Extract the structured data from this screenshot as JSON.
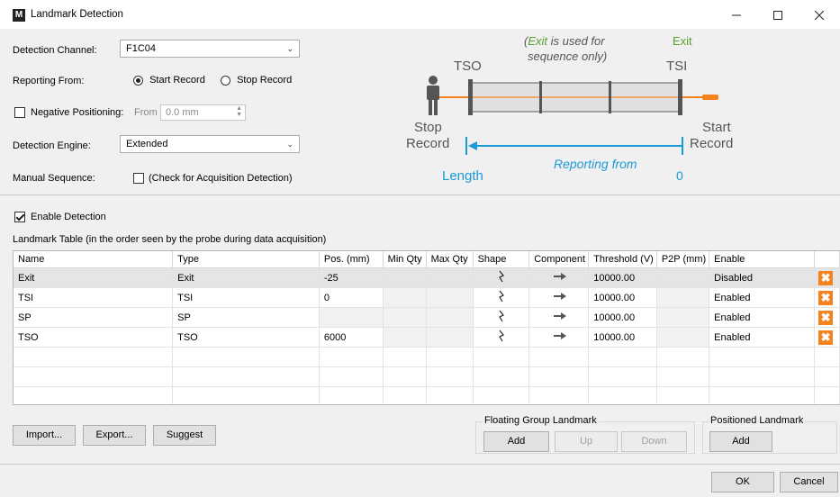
{
  "window": {
    "app_icon": "M",
    "title": "Landmark Detection",
    "minimize_icon": "minimize-icon",
    "maximize_icon": "maximize-icon",
    "close_icon": "close-icon"
  },
  "settings": {
    "detection_channel_label": "Detection Channel:",
    "detection_channel_value": "F1C04",
    "reporting_from_label": "Reporting From:",
    "reporting_options": [
      "Start Record",
      "Stop Record"
    ],
    "reporting_selected": "Start Record",
    "negative_positioning_label": "Negative Positioning:",
    "negative_positioning_checked": false,
    "from_label": "From",
    "from_value": "0.0 mm",
    "detection_engine_label": "Detection Engine:",
    "detection_engine_value": "Extended",
    "manual_sequence_label": "Manual Sequence:",
    "manual_sequence_checkbox_label": "(Check for Acquisition Detection)",
    "manual_sequence_checked": false
  },
  "diagram": {
    "note_exit": "Exit",
    "note_rest": " is used for",
    "note_line2": "sequence only)",
    "note_open_paren": "(",
    "exit_label": "Exit",
    "tso_label": "TSO",
    "tsi_label": "TSI",
    "stop_label_1": "Stop",
    "stop_label_2": "Record",
    "start_label_1": "Start",
    "start_label_2": "Record",
    "length_label": "Length",
    "reporting_from_label": "Reporting from",
    "zero_label": "0",
    "colors": {
      "orange": "#f5821f",
      "blue": "#1a9ad6",
      "green": "#5aa02c",
      "grey_text": "#555555"
    }
  },
  "enable_detection": {
    "label": "Enable Detection",
    "checked": true
  },
  "table": {
    "caption": "Landmark Table (in the order seen by the probe during data acquisition)",
    "columns": [
      "Name",
      "Type",
      "Pos. (mm)",
      "Min Qty",
      "Max Qty",
      "Shape",
      "Component",
      "Threshold (V)",
      "P2P (mm)",
      "Enable",
      ""
    ],
    "rows": [
      {
        "name": "Exit",
        "type": "Exit",
        "pos": "-25",
        "min": "",
        "max": "",
        "shape": "shape-icon",
        "component": "arrow-right-icon",
        "threshold": "10000.00",
        "p2p": "",
        "enable": "Disabled"
      },
      {
        "name": "TSI",
        "type": "TSI",
        "pos": "0",
        "min": "",
        "max": "",
        "shape": "shape-icon",
        "component": "arrow-right-icon",
        "threshold": "10000.00",
        "p2p": "",
        "enable": "Enabled"
      },
      {
        "name": "SP",
        "type": "SP",
        "pos": "",
        "min": "",
        "max": "",
        "shape": "shape-icon",
        "component": "arrow-right-icon",
        "threshold": "10000.00",
        "p2p": "",
        "enable": "Enabled"
      },
      {
        "name": "TSO",
        "type": "TSO",
        "pos": "6000",
        "min": "",
        "max": "",
        "shape": "shape-icon",
        "component": "arrow-right-icon",
        "threshold": "10000.00",
        "p2p": "",
        "enable": "Enabled"
      }
    ],
    "delete_icon": "delete-icon"
  },
  "buttons": {
    "import": "Import...",
    "export": "Export...",
    "suggest": "Suggest",
    "floating_group_title": "Floating Group Landmark",
    "floating_add": "Add",
    "floating_up": "Up",
    "floating_down": "Down",
    "positioned_title": "Positioned Landmark",
    "positioned_add": "Add",
    "ok": "OK",
    "cancel": "Cancel"
  }
}
